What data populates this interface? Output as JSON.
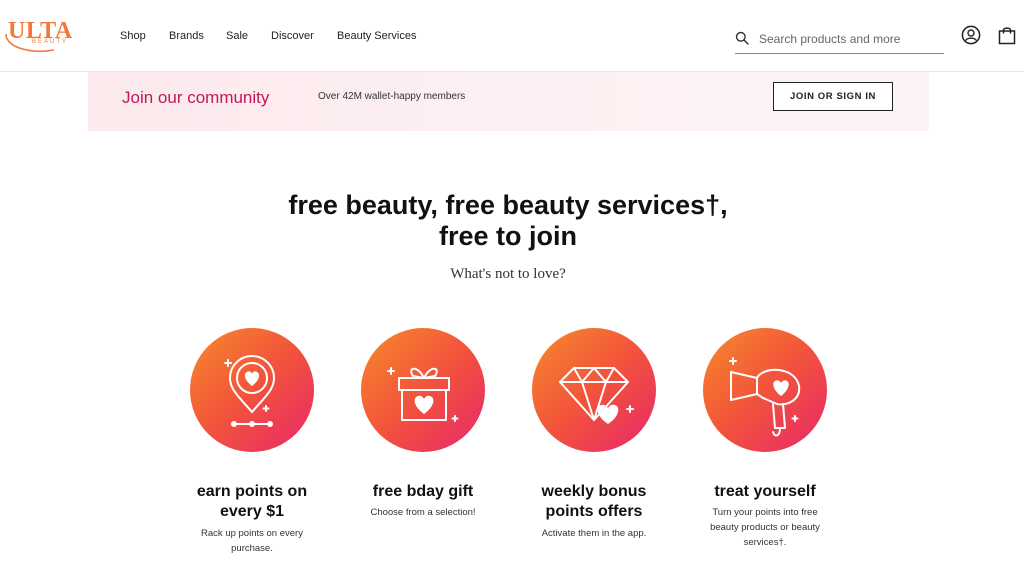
{
  "header": {
    "logo": {
      "text": "ULTA",
      "sub": "BEAUTY"
    },
    "nav": [
      "Shop",
      "Brands",
      "Sale",
      "Discover",
      "Beauty Services"
    ],
    "search": {
      "placeholder": "Search products and more",
      "value": ""
    }
  },
  "banner": {
    "title": "Join our community",
    "subtitle": "Over 42M wallet-happy members",
    "button": "JOIN OR SIGN IN"
  },
  "hero": {
    "headline_line1": "free beauty, free beauty services†,",
    "headline_line2": "free to join",
    "subhead": "What's not to love?"
  },
  "perks": [
    {
      "icon": "location-heart-icon",
      "title_line1": "earn points on",
      "title_line2": "every $1",
      "desc_line1": "Rack up points on every",
      "desc_line2": "purchase.",
      "desc_line3": ""
    },
    {
      "icon": "gift-heart-icon",
      "title_line1": "free bday gift",
      "title_line2": "",
      "desc_line1": "Choose from a selection!",
      "desc_line2": "",
      "desc_line3": ""
    },
    {
      "icon": "diamond-heart-icon",
      "title_line1": "weekly bonus",
      "title_line2": "points offers",
      "desc_line1": "Activate them in the app.",
      "desc_line2": "",
      "desc_line3": ""
    },
    {
      "icon": "hairdryer-heart-icon",
      "title_line1": "treat yourself",
      "title_line2": "",
      "desc_line1": "Turn your points into free",
      "desc_line2": "beauty products or beauty",
      "desc_line3": "services†."
    }
  ],
  "colors": {
    "brand_orange": "#f3783a",
    "accent_pink": "#c2185b",
    "gradient_start": "#f78a2a",
    "gradient_end": "#e8276a",
    "banner_bg": "#fbe9ec"
  }
}
